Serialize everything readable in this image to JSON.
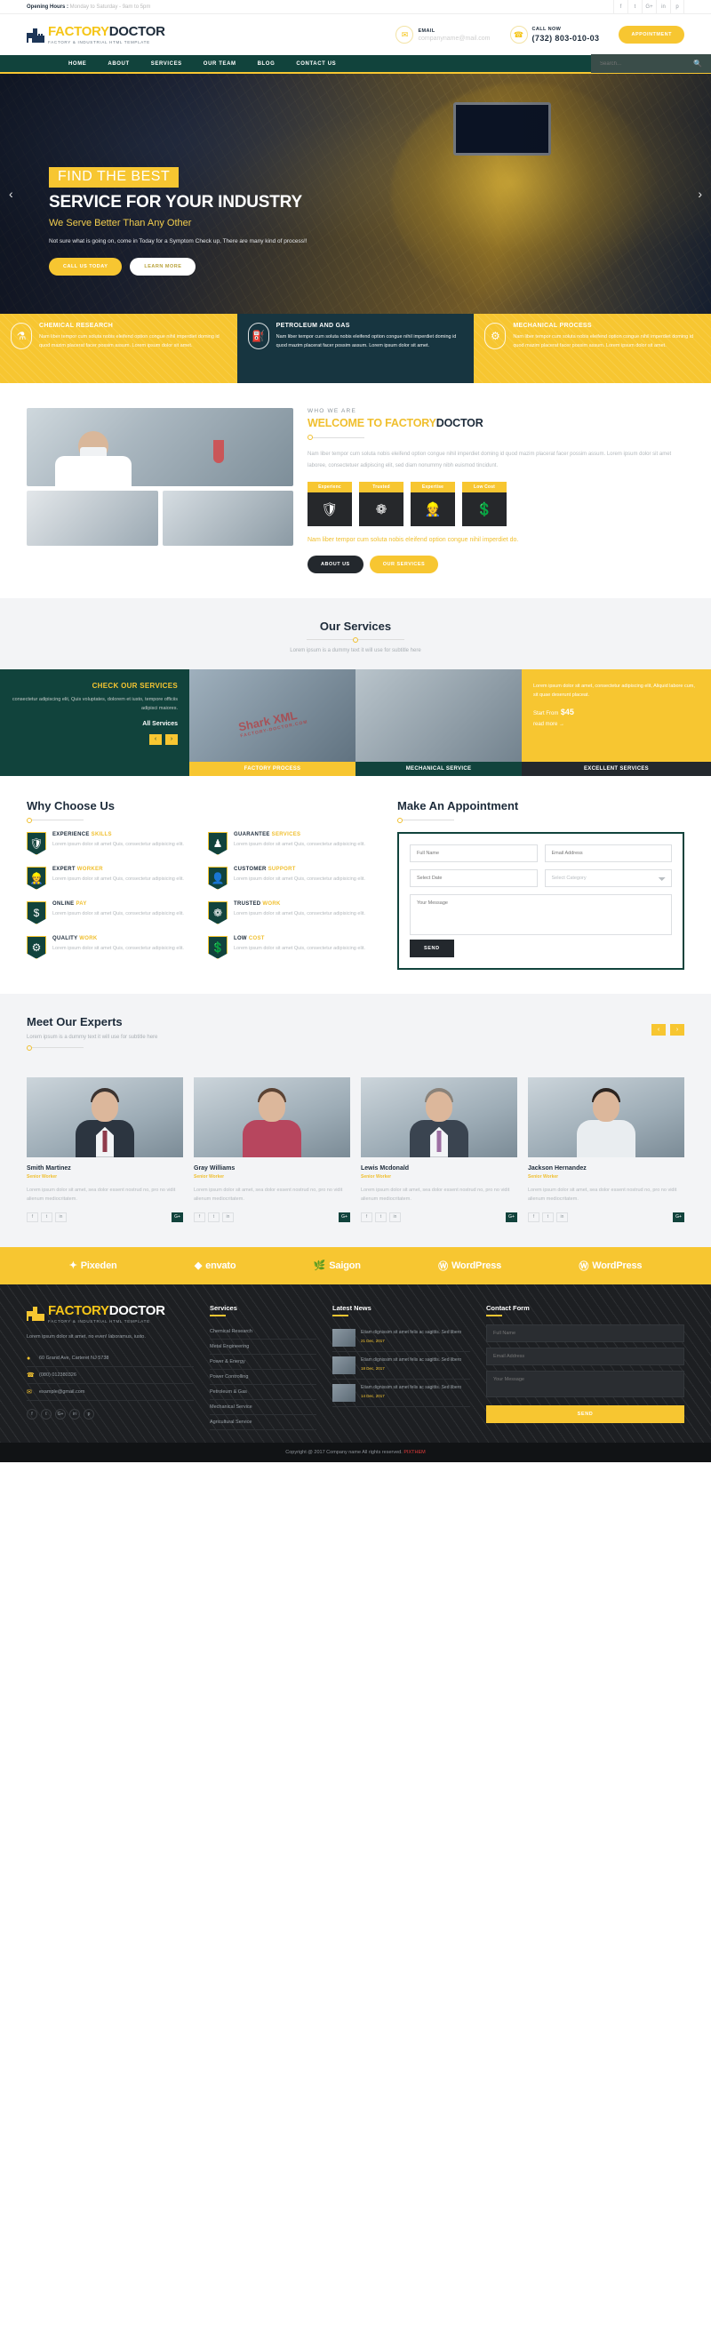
{
  "topbar": {
    "opening_label": "Opening Hours :",
    "opening_value": "Monday to Saturday - 9am to 5pm",
    "socials": [
      "f",
      "t",
      "G+",
      "in",
      "p"
    ]
  },
  "header": {
    "logo_1": "FACTORY",
    "logo_2": "DOCTOR",
    "logo_tagline": "FACTORY & INDUSTRIAL HTML TEMPLATE",
    "email_label": "EMAIL",
    "email_value": "companyname@mail.com",
    "call_label": "CALL NOW",
    "call_value": "(732) 803-010-03",
    "appointment_button": "APPOINTMENT"
  },
  "nav": {
    "items": [
      "HOME",
      "ABOUT",
      "SERVICES",
      "OUR TEAM",
      "BLOG",
      "CONTACT US"
    ],
    "search_placeholder": "Search...",
    "search_value": ""
  },
  "hero": {
    "tag": "FIND THE BEST",
    "title": "SERVICE FOR YOUR INDUSTRY",
    "subtitle": "We Serve Better Than Any Other",
    "paragraph": "Not sure what is going on, come in Today for a Symptom Check up, There are many kind of process!!",
    "btn_primary": "CALL US TODAY",
    "btn_secondary": "LEARN MORE",
    "arrow_left": "‹",
    "arrow_right": "›"
  },
  "features": [
    {
      "title": "CHEMICAL RESEARCH",
      "text": "Nam liber tempor cum soluta nobis eleifend option congue nihil imperdiet doming id quod mazim placerat facer possim assum. Lorem ipsum dolor sit amet.",
      "icon": "flask-icon",
      "glyph": "⚗",
      "style": "y"
    },
    {
      "title": "PETROLEUM AND GAS",
      "text": "Nam liber tempor cum soluta nobis eleifend option congue nihil imperdiet doming id quod mazim placerat facer possim assum. Lorem ipsum dolor sit amet.",
      "icon": "oil-rig-icon",
      "glyph": "⛽",
      "style": "d"
    },
    {
      "title": "MECHANICAL PROCESS",
      "text": "Nam liber tempor cum soluta nobis eleifend option congue nihil imperdiet doming id quod mazim placerat facer possim assum. Lorem ipsum dolor sit amet.",
      "icon": "gear-press-icon",
      "glyph": "⚙",
      "style": "y"
    }
  ],
  "welcome": {
    "kicker": "WHO WE ARE",
    "title_1": "WELCOME TO FACTORY",
    "title_2": "DOCTOR",
    "body": "Nam liber tempor cum soluta nobis eleifend option congue nihil imperdiet doming id quod mazim placerat facer possim assum. Lorem ipsum dolor sit amet laboree, consectetuer adipiscing elit, sed diam nonummy nibh euismod tincidunt.",
    "icons": [
      {
        "cap": "Experienc",
        "glyph": "🛡",
        "name": "shield-icon"
      },
      {
        "cap": "Trusted",
        "glyph": "❁",
        "name": "badge-icon"
      },
      {
        "cap": "Expertise",
        "glyph": "👷",
        "name": "worker-icon"
      },
      {
        "cap": "Low Cost",
        "glyph": "💲",
        "name": "money-hands-icon"
      }
    ],
    "highlight": "Nam liber tempor cum soluta nobis eleifend option congue nihil imperdiet do.",
    "btn_1": "ABOUT US",
    "btn_2": "OUR SERVICES"
  },
  "services": {
    "title": "Our Services",
    "subtitle": "Lorem ipsum is a dummy text it will use for subtitle here",
    "card_teal": {
      "title": "CHECK OUR SERVICES",
      "text": "consectetur adipiscing elit, Quis voluptates, dolorem et iusto, tempore officiis adipisci maiores.",
      "all": "All Services",
      "prev": "‹",
      "next": "›"
    },
    "card_img1_caption": "FACTORY PROCESS",
    "card_img2_caption": "MECHANICAL SERVICE",
    "card_yellow": {
      "text": "Lorem ipsum dolor sit amet, consectetur adipiscing elit, Aliquid labore cum, sit quae deserunt placeat.",
      "price_label": "Start From",
      "price": "$45",
      "more": "read more →",
      "caption": "EXCELLENT SERVICES"
    },
    "watermark": "Shark XML",
    "watermark_sub": "FACTORY-DOCTOR.COM"
  },
  "why": {
    "title": "Why Choose Us",
    "items": [
      {
        "t1": "EXPERIENCE ",
        "t2": "SKILLS",
        "text": "Lorem ipsum dolor sit amet Quis, consectetur adipisicing elit.",
        "icon": "shield-icon",
        "glyph": "🛡"
      },
      {
        "t1": "GUARANTEE ",
        "t2": "SERVICES",
        "text": "Lorem ipsum dolor sit amet Quis, consectetur adipisicing elit.",
        "icon": "trophy-icon",
        "glyph": "♟"
      },
      {
        "t1": "EXPERT ",
        "t2": "WORKER",
        "text": "Lorem ipsum dolor sit amet Quis, consectetur adipisicing elit.",
        "icon": "worker-icon",
        "glyph": "👷"
      },
      {
        "t1": "CUSTOMER ",
        "t2": "SUPPORT",
        "text": "Lorem ipsum dolor sit amet Quis, consectetur adipisicing elit.",
        "icon": "user-icon",
        "glyph": "👤"
      },
      {
        "t1": "ONLINE ",
        "t2": "PAY",
        "text": "Lorem ipsum dolor sit amet Quis, consectetur adipisicing elit.",
        "icon": "dollar-icon",
        "glyph": "$"
      },
      {
        "t1": "TRUSTED ",
        "t2": "WORK",
        "text": "Lorem ipsum dolor sit amet Quis, consectetur adipisicing elit.",
        "icon": "badge-icon",
        "glyph": "❁"
      },
      {
        "t1": "QUALITY ",
        "t2": "WORK",
        "text": "Lorem ipsum dolor sit amet Quis, consectetur adipisicing elit.",
        "icon": "gears-icon",
        "glyph": "⚙"
      },
      {
        "t1": "LOW ",
        "t2": "COST",
        "text": "Lorem ipsum dolor sit amet Quis, consectetur adipisicing elit.",
        "icon": "money-hands-icon",
        "glyph": "💲"
      }
    ]
  },
  "appointment": {
    "title": "Make An Appointment",
    "full_name_placeholder": "Full Name",
    "email_placeholder": "Email Address",
    "date_placeholder": "Select Date",
    "category_placeholder": "Select Category",
    "message_placeholder": "Your Message",
    "send_button": "SEND"
  },
  "experts": {
    "title": "Meet Our Experts",
    "subtitle": "Lorem ipsum is a dummy text it will use for subtitle here",
    "prev": "‹",
    "next": "›",
    "members": [
      {
        "name": "Smith Martinez",
        "role": "Senior Worker",
        "bio": "Lorem ipsum dolor sit amet, sea dolor essent nostrud no, pro no vidit alienum mediocritatem.",
        "socials": [
          "f",
          "t",
          "in",
          "G+"
        ]
      },
      {
        "name": "Gray Williams",
        "role": "Senior Worker",
        "bio": "Lorem ipsum dolor sit amet, sea dolor essent nostrud no, pro no vidit alienum mediocritatem.",
        "socials": [
          "f",
          "t",
          "in",
          "G+"
        ]
      },
      {
        "name": "Lewis Mcdonald",
        "role": "Senior Worker",
        "bio": "Lorem ipsum dolor sit amet, sea dolor essent nostrud no, pro no vidit alienum mediocritatem.",
        "socials": [
          "f",
          "t",
          "in",
          "G+"
        ]
      },
      {
        "name": "Jackson Hernandez",
        "role": "Senior Worker",
        "bio": "Lorem ipsum dolor sit amet, sea dolor essent nostrud no, pro no vidit alienum mediocritatem.",
        "socials": [
          "f",
          "t",
          "in",
          "G+"
        ]
      }
    ]
  },
  "brands": [
    {
      "glyph": "✦",
      "label": "Pixeden"
    },
    {
      "glyph": "◆",
      "label": "envato"
    },
    {
      "glyph": "🌿",
      "label": "Saigon"
    },
    {
      "glyph": "Ⓦ",
      "label": "WordPress"
    },
    {
      "glyph": "Ⓦ",
      "label": "WordPress"
    }
  ],
  "footer": {
    "logo_1": "FACTORY",
    "logo_2": "DOCTOR",
    "logo_tagline": "FACTORY & INDUSTRIAL HTML TEMPLATE",
    "about": "Lorem ipsum dolor sit amet, no even! laboramus, iusto.",
    "address": "60 Grand Ave, Carteret NJ 5738",
    "phone": "(080) 012380326",
    "email": "example@gmail.com",
    "socials": [
      "f",
      "t",
      "G+",
      "in",
      "p"
    ],
    "services_title": "Services",
    "services": [
      "Chemical Research",
      "Metal Engineering",
      "Power & Energy",
      "Power Controlling",
      "Petroleum & Gas",
      "Mechanical Service",
      "Agricultural Service"
    ],
    "news_title": "Latest News",
    "news": [
      {
        "text": "Etiam dignissim sit amet felis ac sagittis. Sed libero",
        "date": "21 Dec, 2017"
      },
      {
        "text": "Etiam dignissim sit amet felis ac sagittis. Sed libero",
        "date": "18 Dec, 2017"
      },
      {
        "text": "Etiam dignissim sit amet felis ac sagittis. Sed libero",
        "date": "14 Dec, 2017"
      }
    ],
    "contact_title": "Contact Form",
    "name_placeholder": "Full Name",
    "email_placeholder": "Email Address",
    "message_placeholder": "Your Message",
    "send_button": "SEND"
  },
  "copyright": {
    "text": "Copyright @ 2017 Company name All rights reserved. ",
    "brand": "PIXTHEM"
  },
  "colors": {
    "yellow": "#f7c631",
    "teal": "#11433c",
    "dark": "#1d2b3a",
    "navy": "#1d3557"
  }
}
